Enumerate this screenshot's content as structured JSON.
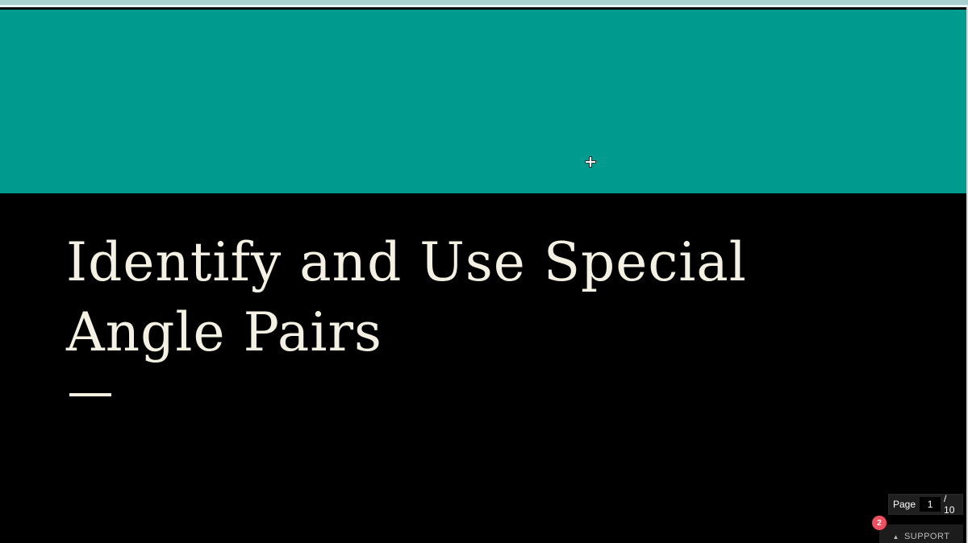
{
  "slide": {
    "title": "Identify and Use Special Angle Pairs",
    "colors": {
      "header_band": "#009b8f",
      "background": "#000000",
      "title_text": "#f4f0e2"
    }
  },
  "pager": {
    "label": "Page",
    "current": "1",
    "total": "/ 10"
  },
  "support": {
    "label": "SUPPORT",
    "caret_icon": "caret-up-icon",
    "badge_count": "2",
    "badge_color": "#ef4f5f"
  },
  "cursor": {
    "icon": "crosshair-cursor-icon"
  }
}
